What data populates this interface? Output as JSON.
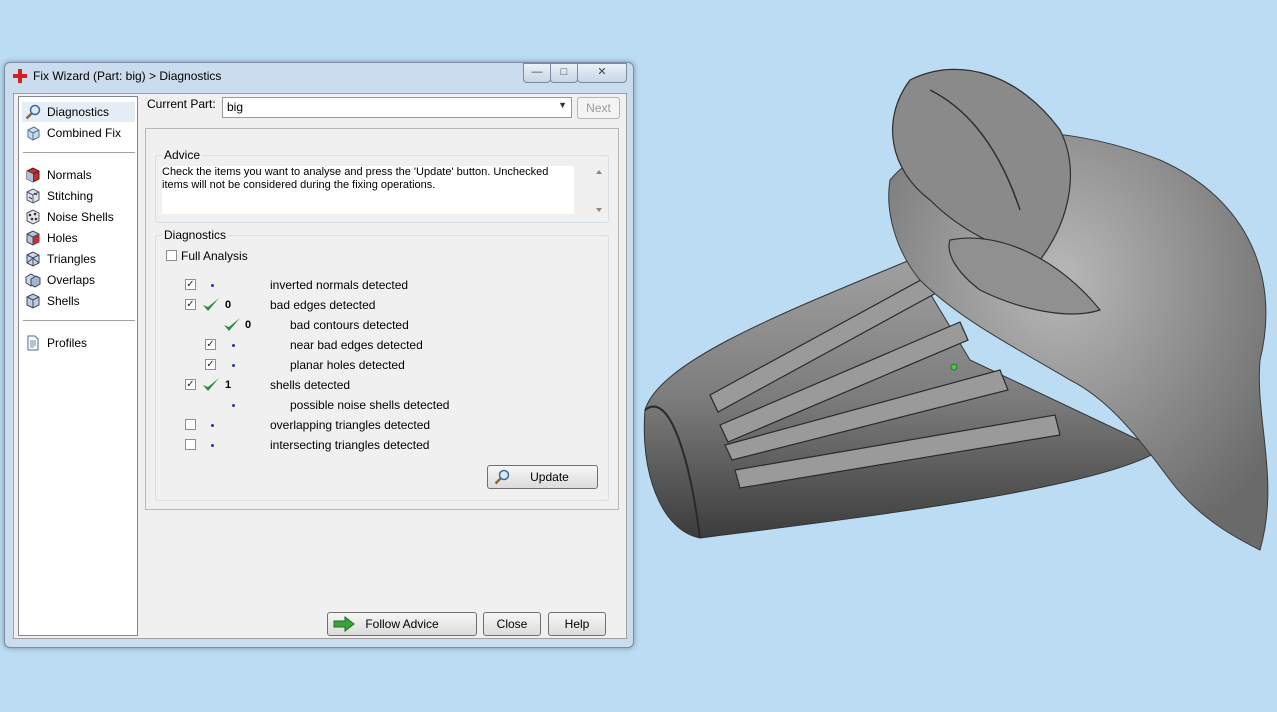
{
  "window": {
    "title": "Fix Wizard (Part: big) > Diagnostics",
    "controls": {
      "minimize": "—",
      "maximize": "□",
      "close": "✕"
    }
  },
  "sidebar": {
    "group1": [
      {
        "label": "Diagnostics",
        "icon": "magnifier-icon"
      },
      {
        "label": "Combined Fix",
        "icon": "cube-icon"
      }
    ],
    "group2": [
      {
        "label": "Normals",
        "icon": "normals-icon"
      },
      {
        "label": "Stitching",
        "icon": "stitching-icon"
      },
      {
        "label": "Noise Shells",
        "icon": "noise-shells-icon"
      },
      {
        "label": "Holes",
        "icon": "holes-icon"
      },
      {
        "label": "Triangles",
        "icon": "triangles-icon"
      },
      {
        "label": "Overlaps",
        "icon": "overlaps-icon"
      },
      {
        "label": "Shells",
        "icon": "shells-icon"
      }
    ],
    "group3": [
      {
        "label": "Profiles",
        "icon": "document-icon"
      }
    ]
  },
  "header": {
    "current_part_label": "Current Part:",
    "current_part_value": "big",
    "next_label": "Next"
  },
  "advice": {
    "title": "Advice",
    "text": "Check the items you want to analyse and press the 'Update' button. Unchecked items will not be considered during the fixing operations."
  },
  "diagnostics": {
    "title": "Diagnostics",
    "full_analysis": "Full Analysis",
    "rows": [
      {
        "label": "inverted normals detected",
        "count": "",
        "checked": true
      },
      {
        "label": "bad edges detected",
        "count": "0",
        "checked": true
      },
      {
        "label": "bad contours detected",
        "count": "0",
        "checked": null
      },
      {
        "label": "near bad edges detected",
        "count": "",
        "checked": true
      },
      {
        "label": "planar holes detected",
        "count": "",
        "checked": true
      },
      {
        "label": "shells detected",
        "count": "1",
        "checked": true
      },
      {
        "label": "possible noise shells detected",
        "count": "",
        "checked": null
      },
      {
        "label": "overlapping triangles detected",
        "count": "",
        "checked": false
      },
      {
        "label": "intersecting triangles detected",
        "count": "",
        "checked": false
      }
    ],
    "update_label": "Update"
  },
  "footer": {
    "follow_advice_label": "Follow Advice",
    "close_label": "Close",
    "help_label": "Help"
  },
  "colors": {
    "desktop": "#bcdcf4",
    "window_frame": "#cbdcee",
    "check_green": "#2f8a3a",
    "dot_blue": "#1a3aa0"
  }
}
